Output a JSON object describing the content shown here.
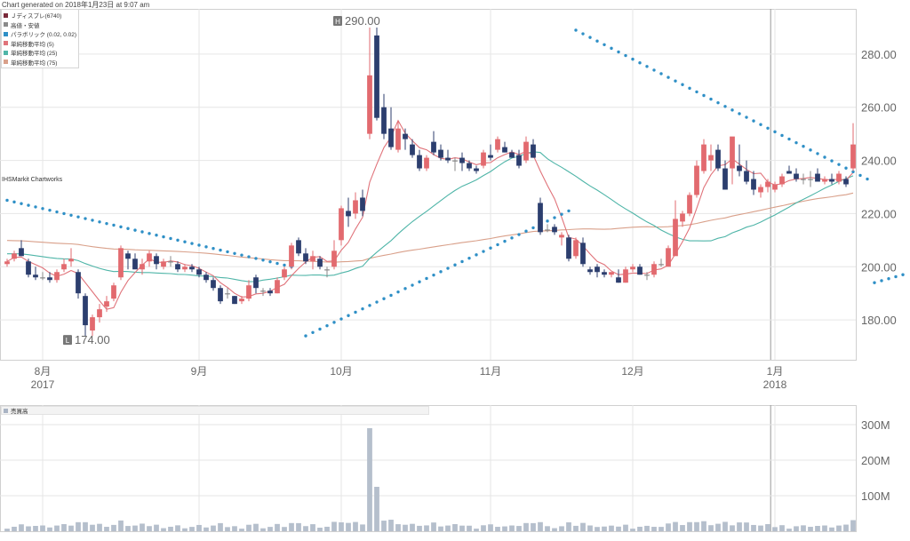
{
  "header": {
    "generated": "Chart generated on 2018年1月23日 at 9:07 am"
  },
  "legend": {
    "items": [
      {
        "label": "Ｊディスプレ(6740)",
        "color": "#7a2a3a"
      },
      {
        "label": "高値・安値",
        "color": "#8a8a8a"
      },
      {
        "label": "パラボリック (0.02, 0.02)",
        "color": "#2e8fc6"
      },
      {
        "label": "単純移動平均 (5)",
        "color": "#e0737a"
      },
      {
        "label": "単純移動平均 (25)",
        "color": "#4fb5a8"
      },
      {
        "label": "単純移動平均 (75)",
        "color": "#d9a08a"
      }
    ]
  },
  "source": "IHSMarkit Chartworks",
  "volume_legend": "売買高",
  "chart_data": [
    {
      "type": "candlestick",
      "title": "",
      "ylim": [
        165,
        297
      ],
      "yticks": [
        "180.00",
        "200.00",
        "220.00",
        "240.00",
        "260.00",
        "280.00"
      ],
      "x_month_labels": [
        {
          "label": "8月",
          "sub": "2017",
          "date": "2017-08-01"
        },
        {
          "label": "9月",
          "sub": "",
          "date": "2017-09-01"
        },
        {
          "label": "10月",
          "sub": "",
          "date": "2017-10-02"
        },
        {
          "label": "11月",
          "sub": "",
          "date": "2017-11-01"
        },
        {
          "label": "12月",
          "sub": "",
          "date": "2017-12-01"
        },
        {
          "label": "1月",
          "sub": "2018",
          "date": "2018-01-04"
        }
      ],
      "annotations": [
        {
          "tag": "H",
          "text": "290.00",
          "value": 290,
          "date": "2017-10-04"
        },
        {
          "tag": "L",
          "text": "174.00",
          "value": 174,
          "date": "2017-08-09"
        }
      ],
      "grid": true,
      "colors": {
        "up": "#e26a6f",
        "down": "#2c3e6e",
        "flat": "#888888",
        "parabolic": "#2e8fc6",
        "ma5": "#e0737a",
        "ma25": "#4fb5a8",
        "ma75": "#d9a08a"
      },
      "series": [
        {
          "name": "Ｊディスプレ(6740)",
          "ohlc": [
            [
              "2017-07-25",
              201,
              203,
              200,
              202
            ],
            [
              "2017-07-26",
              203,
              206,
              202,
              205
            ],
            [
              "2017-07-27",
              207,
              210,
              204,
              204
            ],
            [
              "2017-07-28",
              202,
              203,
              196,
              197
            ],
            [
              "2017-07-31",
              197,
              200,
              195,
              196
            ],
            [
              "2017-08-01",
              196,
              198,
              195,
              196
            ],
            [
              "2017-08-02",
              196,
              198,
              194,
              195
            ],
            [
              "2017-08-03",
              195,
              199,
              194,
              198
            ],
            [
              "2017-08-04",
              199,
              203,
              198,
              201
            ],
            [
              "2017-08-07",
              202,
              207,
              200,
              203
            ],
            [
              "2017-08-08",
              198,
              199,
              188,
              190
            ],
            [
              "2017-08-09",
              189,
              190,
              174,
              178
            ],
            [
              "2017-08-10",
              176,
              182,
              174,
              181
            ],
            [
              "2017-08-14",
              181,
              186,
              179,
              184
            ],
            [
              "2017-08-15",
              185,
              189,
              183,
              187
            ],
            [
              "2017-08-16",
              188,
              194,
              187,
              193
            ],
            [
              "2017-08-17",
              196,
              208,
              195,
              207
            ],
            [
              "2017-08-18",
              205,
              206,
              199,
              203
            ],
            [
              "2017-08-21",
              203,
              205,
              200,
              199
            ],
            [
              "2017-08-22",
              199,
              203,
              197,
              201
            ],
            [
              "2017-08-23",
              202,
              206,
              200,
              205
            ],
            [
              "2017-08-24",
              204,
              205,
              199,
              201
            ],
            [
              "2017-08-25",
              200,
              203,
              199,
              202
            ],
            [
              "2017-08-28",
              202,
              204,
              200,
              202
            ],
            [
              "2017-08-29",
              201,
              202,
              198,
              199
            ],
            [
              "2017-08-30",
              199,
              201,
              198,
              200
            ],
            [
              "2017-08-31",
              200,
              201,
              198,
              199
            ],
            [
              "2017-09-01",
              199,
              200,
              196,
              197
            ],
            [
              "2017-09-04",
              197,
              198,
              194,
              195
            ],
            [
              "2017-09-05",
              195,
              196,
              191,
              192
            ],
            [
              "2017-09-06",
              192,
              193,
              186,
              187
            ],
            [
              "2017-09-07",
              190,
              192,
              188,
              190
            ],
            [
              "2017-09-08",
              189,
              189,
              186,
              186
            ],
            [
              "2017-09-11",
              187,
              189,
              186,
              188
            ],
            [
              "2017-09-12",
              188,
              195,
              187,
              193
            ],
            [
              "2017-09-13",
              196,
              197,
              190,
              192
            ],
            [
              "2017-09-14",
              191,
              192,
              189,
              191
            ],
            [
              "2017-09-15",
              191,
              192,
              189,
              190
            ],
            [
              "2017-09-19",
              190,
              196,
              190,
              195
            ],
            [
              "2017-09-20",
              196,
              200,
              195,
              199
            ],
            [
              "2017-09-21",
              200,
              209,
              199,
              208
            ],
            [
              "2017-09-22",
              210,
              211,
              204,
              205
            ],
            [
              "2017-09-25",
              205,
              207,
              201,
              202
            ],
            [
              "2017-09-26",
              202,
              206,
              199,
              204
            ],
            [
              "2017-09-27",
              203,
              204,
              199,
              200
            ],
            [
              "2017-09-28",
              199,
              200,
              196,
              199
            ],
            [
              "2017-09-29",
              200,
              210,
              199,
              206
            ],
            [
              "2017-10-02",
              210,
              223,
              208,
              222
            ],
            [
              "2017-10-03",
              221,
              226,
              215,
              219
            ],
            [
              "2017-10-04",
              220,
              228,
              218,
              225
            ],
            [
              "2017-10-05",
              226,
              229,
              219,
              221
            ],
            [
              "2017-10-06",
              250,
              290,
              248,
              272
            ],
            [
              "2017-10-10",
              287,
              290,
              255,
              256
            ],
            [
              "2017-10-11",
              260,
              265,
              248,
              250
            ],
            [
              "2017-10-12",
              252,
              260,
              244,
              245
            ],
            [
              "2017-10-13",
              244,
              255,
              243,
              252
            ],
            [
              "2017-10-16",
              250,
              252,
              244,
              248
            ],
            [
              "2017-10-17",
              246,
              248,
              241,
              242
            ],
            [
              "2017-10-18",
              242,
              244,
              236,
              237
            ],
            [
              "2017-10-19",
              237,
              242,
              236,
              241
            ],
            [
              "2017-10-20",
              247,
              251,
              242,
              243
            ],
            [
              "2017-10-23",
              244,
              246,
              240,
              241
            ],
            [
              "2017-10-24",
              241,
              244,
              239,
              240
            ],
            [
              "2017-10-25",
              240,
              241,
              236,
              240
            ],
            [
              "2017-10-26",
              241,
              243,
              236,
              239
            ],
            [
              "2017-10-27",
              239,
              240,
              236,
              237
            ],
            [
              "2017-10-30",
              237,
              238,
              235,
              236
            ],
            [
              "2017-10-31",
              238,
              244,
              237,
              243
            ],
            [
              "2017-11-01",
              242,
              246,
              240,
              241
            ],
            [
              "2017-11-02",
              244,
              249,
              243,
              248
            ],
            [
              "2017-11-06",
              245,
              247,
              243,
              243
            ],
            [
              "2017-11-07",
              243,
              244,
              241,
              241
            ],
            [
              "2017-11-08",
              242,
              244,
              237,
              238
            ],
            [
              "2017-11-09",
              240,
              249,
              239,
              247
            ],
            [
              "2017-11-10",
              246,
              248,
              241,
              241
            ],
            [
              "2017-11-13",
              224,
              226,
              212,
              213
            ],
            [
              "2017-11-14",
              214,
              216,
              213,
              214
            ],
            [
              "2017-11-15",
              215,
              216,
              212,
              213
            ],
            [
              "2017-11-16",
              211,
              213,
              208,
              212
            ],
            [
              "2017-11-17",
              211,
              212,
              202,
              203
            ],
            [
              "2017-11-20",
              204,
              211,
              203,
              210
            ],
            [
              "2017-11-21",
              209,
              211,
              200,
              201
            ],
            [
              "2017-11-22",
              199,
              200,
              197,
              198
            ],
            [
              "2017-11-24",
              200,
              201,
              196,
              198
            ],
            [
              "2017-11-27",
              198,
              199,
              196,
              197
            ],
            [
              "2017-11-28",
              197,
              198,
              196,
              198
            ],
            [
              "2017-11-29",
              196,
              199,
              194,
              194
            ],
            [
              "2017-11-30",
              194,
              200,
              194,
              199
            ],
            [
              "2017-12-01",
              199,
              201,
              198,
              200
            ],
            [
              "2017-12-04",
              200,
              201,
              197,
              197
            ],
            [
              "2017-12-05",
              197,
              198,
              195,
              197
            ],
            [
              "2017-12-06",
              197,
              202,
              196,
              201
            ],
            [
              "2017-12-07",
              201,
              203,
              200,
              201
            ],
            [
              "2017-12-08",
              200,
              208,
              201,
              207
            ],
            [
              "2017-12-11",
              204,
              225,
              210,
              218
            ],
            [
              "2017-12-12",
              217,
              221,
              215,
              220
            ],
            [
              "2017-12-13",
              220,
              228,
              219,
              227
            ],
            [
              "2017-12-14",
              227,
              240,
              226,
              238
            ],
            [
              "2017-12-15",
              236,
              248,
              235,
              246
            ],
            [
              "2017-12-18",
              240,
              246,
              236,
              242
            ],
            [
              "2017-12-19",
              244,
              246,
              236,
              237
            ],
            [
              "2017-12-20",
              237,
              240,
              229,
              229
            ],
            [
              "2017-12-21",
              237,
              240,
              231,
              249
            ],
            [
              "2017-12-22",
              238,
              246,
              234,
              236
            ],
            [
              "2017-12-25",
              236,
              240,
              231,
              232
            ],
            [
              "2017-12-26",
              233,
              236,
              227,
              229
            ],
            [
              "2017-12-27",
              228,
              231,
              226,
              230
            ],
            [
              "2017-12-28",
              230,
              233,
              228,
              232
            ],
            [
              "2018-01-04",
              229,
              232,
              228,
              231
            ],
            [
              "2018-01-05",
              231,
              235,
              230,
              234
            ],
            [
              "2018-01-09",
              236,
              238,
              235,
              235
            ],
            [
              "2018-01-10",
              235,
              237,
              232,
              233
            ],
            [
              "2018-01-11",
              233,
              235,
              231,
              233
            ],
            [
              "2018-01-12",
              233,
              236,
              230,
              233
            ],
            [
              "2018-01-15",
              235,
              237,
              232,
              232
            ],
            [
              "2018-01-16",
              232,
              234,
              231,
              233
            ],
            [
              "2018-01-17",
              233,
              235,
              231,
              232
            ],
            [
              "2018-01-18",
              232,
              236,
              231,
              235
            ],
            [
              "2018-01-19",
              233,
              234,
              230,
              231
            ],
            [
              "2018-01-22",
              237,
              254,
              236,
              246
            ]
          ]
        },
        {
          "name": "パラボリック (0.02, 0.02)",
          "segments": [
            {
              "x": [
                0,
                40
              ],
              "y": [
                225,
                200
              ]
            },
            {
              "x": [
                42,
                79
              ],
              "y": [
                174,
                221
              ]
            },
            {
              "x": [
                80,
                121
              ],
              "y": [
                289,
                233
              ]
            },
            {
              "x": [
                122,
                126
              ],
              "y": [
                194,
                197
              ]
            }
          ]
        }
      ]
    },
    {
      "type": "bar",
      "title": "売買高",
      "ylim": [
        0,
        330
      ],
      "yticks": [
        "100M",
        "200M",
        "300M"
      ],
      "unit": "M",
      "peaks": [
        {
          "index": 51,
          "value": 290
        },
        {
          "index": 52,
          "value": 125
        }
      ]
    }
  ]
}
